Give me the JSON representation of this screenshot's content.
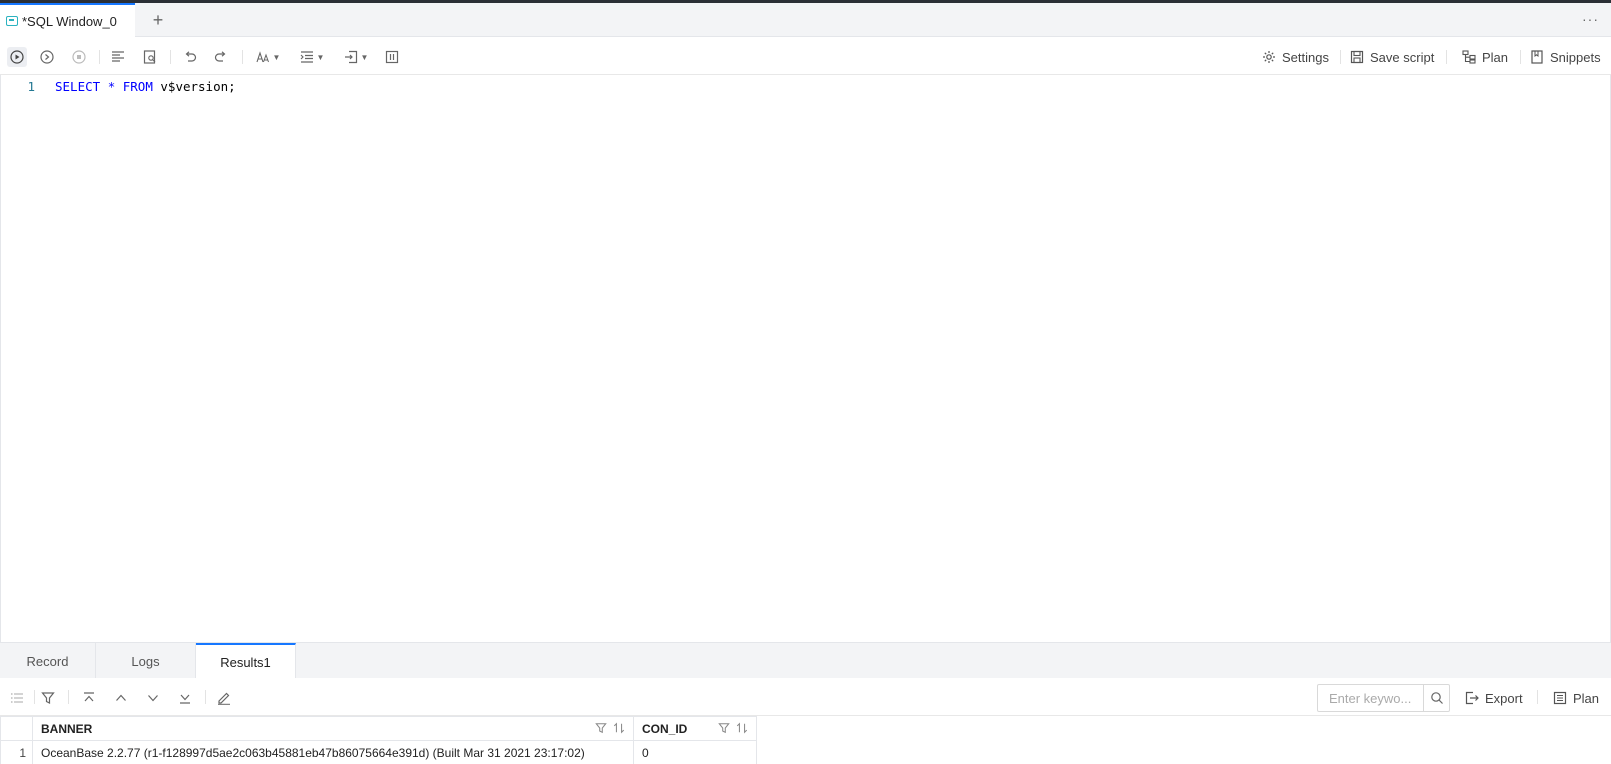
{
  "window": {
    "tab_title": "*SQL Window_0",
    "add_tab": "+",
    "more": "···"
  },
  "toolbar": {
    "settings_label": "Settings",
    "save_script_label": "Save script",
    "plan_label": "Plan",
    "snippets_label": "Snippets"
  },
  "editor": {
    "line_number": "1",
    "tokens": {
      "select": "SELECT",
      "star": "*",
      "from": "FROM",
      "rest": "v$version;"
    }
  },
  "bottom_tabs": {
    "record": "Record",
    "logs": "Logs",
    "results": "Results1"
  },
  "results_toolbar": {
    "search_placeholder": "Enter keywo...",
    "export_label": "Export",
    "plan_label": "Plan"
  },
  "grid": {
    "columns": [
      "BANNER",
      "CON_ID"
    ],
    "rows": [
      {
        "num": "1",
        "banner": "OceanBase 2.2.77 (r1-f128997d5ae2c063b45881eb47b86075664e391d) (Built Mar 31 2021 23:17:02)",
        "con_id": "0"
      }
    ]
  },
  "colors": {
    "accent": "#1677ff",
    "keyword": "#0000ff",
    "line_number": "#237893"
  }
}
